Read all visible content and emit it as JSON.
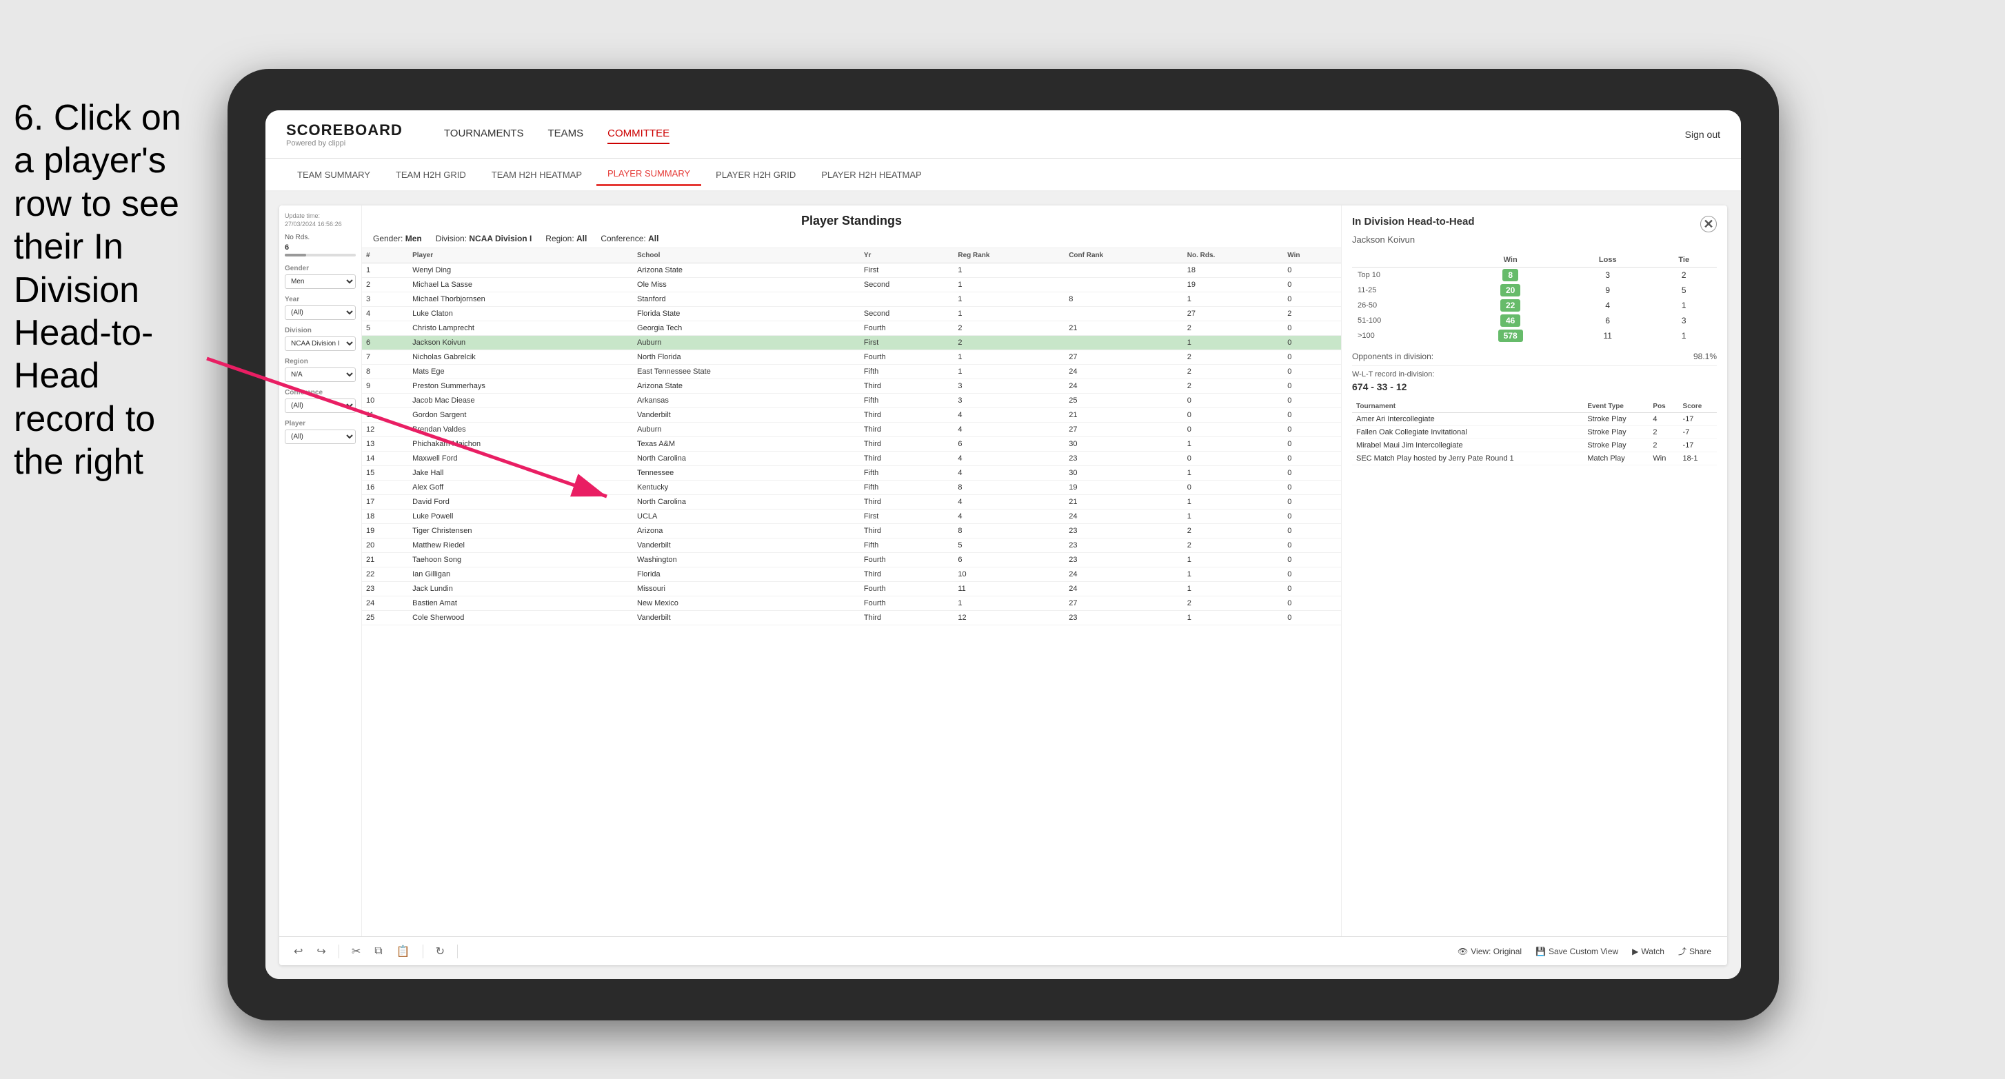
{
  "instruction": {
    "text": "6. Click on a player's row to see their In Division Head-to-Head record to the right"
  },
  "nav": {
    "logo_main": "SCOREBOARD",
    "logo_sub": "Powered by clippi",
    "links": [
      "TOURNAMENTS",
      "TEAMS",
      "COMMITTEE"
    ],
    "active_link": "COMMITTEE",
    "sign_out": "Sign out"
  },
  "sub_nav": {
    "links": [
      "TEAM SUMMARY",
      "TEAM H2H GRID",
      "TEAM H2H HEATMAP",
      "PLAYER SUMMARY",
      "PLAYER H2H GRID",
      "PLAYER H2H HEATMAP"
    ],
    "active_link": "PLAYER SUMMARY"
  },
  "filters": {
    "update_label": "Update time:",
    "update_time": "27/03/2024 16:56:26",
    "no_rds_label": "No Rds.",
    "no_rds_value": "6",
    "gender_label": "Gender",
    "gender_value": "Men",
    "year_label": "Year",
    "year_value": "(All)",
    "division_label": "Division",
    "division_value": "NCAA Division I",
    "region_label": "Region",
    "region_value": "N/A",
    "conference_label": "Conference",
    "conference_value": "(All)",
    "player_label": "Player",
    "player_value": "(All)"
  },
  "standings": {
    "title": "Player Standings",
    "gender_label": "Gender:",
    "gender_value": "Men",
    "division_label": "Division:",
    "division_value": "NCAA Division I",
    "region_label": "Region:",
    "region_value": "All",
    "conference_label": "Conference:",
    "conference_value": "All",
    "columns": [
      "#",
      "Player",
      "School",
      "Yr",
      "Reg Rank",
      "Conf Rank",
      "No. Rds.",
      "Win"
    ],
    "rows": [
      {
        "num": 1,
        "player": "Wenyi Ding",
        "school": "Arizona State",
        "yr": "First",
        "reg_rank": 1,
        "conf_rank": "",
        "no_rds": 18,
        "win": 0,
        "selected": false
      },
      {
        "num": 2,
        "player": "Michael La Sasse",
        "school": "Ole Miss",
        "yr": "Second",
        "reg_rank": 1,
        "conf_rank": "",
        "no_rds": 19,
        "win": 0,
        "selected": false
      },
      {
        "num": 3,
        "player": "Michael Thorbjornsen",
        "school": "Stanford",
        "yr": "",
        "reg_rank": 1,
        "conf_rank": 8,
        "no_rds": 1,
        "win": 0,
        "selected": false
      },
      {
        "num": 4,
        "player": "Luke Claton",
        "school": "Florida State",
        "yr": "Second",
        "reg_rank": 1,
        "conf_rank": "",
        "no_rds": 27,
        "win": 2,
        "selected": false
      },
      {
        "num": 5,
        "player": "Christo Lamprecht",
        "school": "Georgia Tech",
        "yr": "Fourth",
        "reg_rank": 2,
        "conf_rank": 21,
        "no_rds": 2,
        "win": 0,
        "selected": false
      },
      {
        "num": 6,
        "player": "Jackson Koivun",
        "school": "Auburn",
        "yr": "First",
        "reg_rank": 2,
        "conf_rank": "",
        "no_rds": 1,
        "win": 0,
        "selected": true
      },
      {
        "num": 7,
        "player": "Nicholas Gabrelcik",
        "school": "North Florida",
        "yr": "Fourth",
        "reg_rank": 1,
        "conf_rank": 27,
        "no_rds": 2,
        "win": 0,
        "selected": false
      },
      {
        "num": 8,
        "player": "Mats Ege",
        "school": "East Tennessee State",
        "yr": "Fifth",
        "reg_rank": 1,
        "conf_rank": 24,
        "no_rds": 2,
        "win": 0,
        "selected": false
      },
      {
        "num": 9,
        "player": "Preston Summerhays",
        "school": "Arizona State",
        "yr": "Third",
        "reg_rank": 3,
        "conf_rank": 24,
        "no_rds": 2,
        "win": 0,
        "selected": false
      },
      {
        "num": 10,
        "player": "Jacob Mac Diease",
        "school": "Arkansas",
        "yr": "Fifth",
        "reg_rank": 3,
        "conf_rank": 25,
        "no_rds": 0,
        "win": 0,
        "selected": false
      },
      {
        "num": 11,
        "player": "Gordon Sargent",
        "school": "Vanderbilt",
        "yr": "Third",
        "reg_rank": 4,
        "conf_rank": 21,
        "no_rds": 0,
        "win": 0,
        "selected": false
      },
      {
        "num": 12,
        "player": "Brendan Valdes",
        "school": "Auburn",
        "yr": "Third",
        "reg_rank": 4,
        "conf_rank": 27,
        "no_rds": 0,
        "win": 0,
        "selected": false
      },
      {
        "num": 13,
        "player": "Phichakam Maichon",
        "school": "Texas A&M",
        "yr": "Third",
        "reg_rank": 6,
        "conf_rank": 30,
        "no_rds": 1,
        "win": 0,
        "selected": false
      },
      {
        "num": 14,
        "player": "Maxwell Ford",
        "school": "North Carolina",
        "yr": "Third",
        "reg_rank": 4,
        "conf_rank": 23,
        "no_rds": 0,
        "win": 0,
        "selected": false
      },
      {
        "num": 15,
        "player": "Jake Hall",
        "school": "Tennessee",
        "yr": "Fifth",
        "reg_rank": 4,
        "conf_rank": 30,
        "no_rds": 1,
        "win": 0,
        "selected": false
      },
      {
        "num": 16,
        "player": "Alex Goff",
        "school": "Kentucky",
        "yr": "Fifth",
        "reg_rank": 8,
        "conf_rank": 19,
        "no_rds": 0,
        "win": 0,
        "selected": false
      },
      {
        "num": 17,
        "player": "David Ford",
        "school": "North Carolina",
        "yr": "Third",
        "reg_rank": 4,
        "conf_rank": 21,
        "no_rds": 1,
        "win": 0,
        "selected": false
      },
      {
        "num": 18,
        "player": "Luke Powell",
        "school": "UCLA",
        "yr": "First",
        "reg_rank": 4,
        "conf_rank": 24,
        "no_rds": 1,
        "win": 0,
        "selected": false
      },
      {
        "num": 19,
        "player": "Tiger Christensen",
        "school": "Arizona",
        "yr": "Third",
        "reg_rank": 8,
        "conf_rank": 23,
        "no_rds": 2,
        "win": 0,
        "selected": false
      },
      {
        "num": 20,
        "player": "Matthew Riedel",
        "school": "Vanderbilt",
        "yr": "Fifth",
        "reg_rank": 5,
        "conf_rank": 23,
        "no_rds": 2,
        "win": 0,
        "selected": false
      },
      {
        "num": 21,
        "player": "Taehoon Song",
        "school": "Washington",
        "yr": "Fourth",
        "reg_rank": 6,
        "conf_rank": 23,
        "no_rds": 1,
        "win": 0,
        "selected": false
      },
      {
        "num": 22,
        "player": "Ian Gilligan",
        "school": "Florida",
        "yr": "Third",
        "reg_rank": 10,
        "conf_rank": 24,
        "no_rds": 1,
        "win": 0,
        "selected": false
      },
      {
        "num": 23,
        "player": "Jack Lundin",
        "school": "Missouri",
        "yr": "Fourth",
        "reg_rank": 11,
        "conf_rank": 24,
        "no_rds": 1,
        "win": 0,
        "selected": false
      },
      {
        "num": 24,
        "player": "Bastien Amat",
        "school": "New Mexico",
        "yr": "Fourth",
        "reg_rank": 1,
        "conf_rank": 27,
        "no_rds": 2,
        "win": 0,
        "selected": false
      },
      {
        "num": 25,
        "player": "Cole Sherwood",
        "school": "Vanderbilt",
        "yr": "Third",
        "reg_rank": 12,
        "conf_rank": 23,
        "no_rds": 1,
        "win": 0,
        "selected": false
      }
    ]
  },
  "h2h": {
    "title": "In Division Head-to-Head",
    "player": "Jackson Koivun",
    "table_headers": [
      "",
      "Win",
      "Loss",
      "Tie"
    ],
    "rows": [
      {
        "rank": "Top 10",
        "win": 8,
        "loss": 3,
        "tie": 2
      },
      {
        "rank": "11-25",
        "win": 20,
        "loss": 9,
        "tie": 5
      },
      {
        "rank": "26-50",
        "win": 22,
        "loss": 4,
        "tie": 1
      },
      {
        "rank": "51-100",
        "win": 46,
        "loss": 6,
        "tie": 3
      },
      {
        "rank": ">100",
        "win": 578,
        "loss": 11,
        "tie": 1
      }
    ],
    "opponents_label": "Opponents in division:",
    "opponents_value": "98.1%",
    "wlt_label": "W-L-T record in-division:",
    "wlt_value": "674 - 33 - 12",
    "tournament_headers": [
      "Tournament",
      "Event Type",
      "Pos",
      "Score"
    ],
    "tournaments": [
      {
        "name": "Amer Ari Intercollegiate",
        "type": "Stroke Play",
        "pos": 4,
        "score": -17
      },
      {
        "name": "Fallen Oak Collegiate Invitational",
        "type": "Stroke Play",
        "pos": 2,
        "score": -7
      },
      {
        "name": "Mirabel Maui Jim Intercollegiate",
        "type": "Stroke Play",
        "pos": 2,
        "score": -17
      },
      {
        "name": "SEC Match Play hosted by Jerry Pate Round 1",
        "type": "Match Play",
        "pos": "Win",
        "score": "18-1"
      }
    ]
  },
  "toolbar": {
    "undo": "↩",
    "redo": "↪",
    "view_original": "View: Original",
    "save_custom": "Save Custom View",
    "watch": "Watch",
    "share": "Share"
  }
}
